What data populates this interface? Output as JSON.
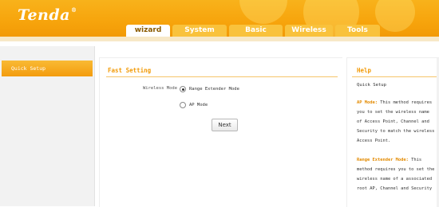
{
  "brand": {
    "logo": "Tenda",
    "reg": "®"
  },
  "tabs": [
    {
      "label": "wizard",
      "active": true
    },
    {
      "label": "System Status",
      "active": false
    },
    {
      "label": "Basic Settings",
      "active": false
    },
    {
      "label": "Wireless",
      "active": false
    },
    {
      "label": "Tools",
      "active": false
    }
  ],
  "sidebar": {
    "items": [
      {
        "label": "Quick Setup"
      }
    ]
  },
  "main": {
    "title": "Fast Setting",
    "wireless_mode_label": "Wireless Mode",
    "options": [
      {
        "label": "Range Extender Mode",
        "checked": true
      },
      {
        "label": "AP Mode",
        "checked": false
      }
    ],
    "next_label": "Next"
  },
  "help": {
    "title": "Help",
    "subtitle": "Quick Setup",
    "ap_title": "AP Mode:",
    "ap_text": " This method requires you to set the wireless name of Access Point, Channel and Security to match the wireless Access Point.",
    "re_title": "Range Extender Mode:",
    "re_text": " This method requires you to set the wireless name of a associated root AP, Channel and Security"
  },
  "colors": {
    "accent": "#f7a40c",
    "help_highlight": "#e38a00"
  }
}
